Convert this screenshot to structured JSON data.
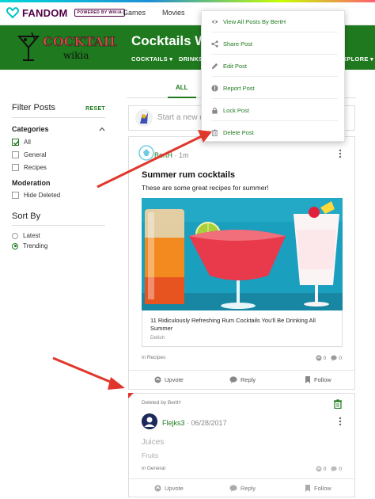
{
  "brand": {
    "name": "FANDOM",
    "powered": "POWERED BY WIKIA"
  },
  "topnav": [
    "Games",
    "Movies"
  ],
  "wiki": {
    "logo_line1": "COCKTAILS",
    "logo_line2": "wikia",
    "title": "Cocktails W",
    "nav": [
      {
        "label": "COCKTAILS ▾"
      },
      {
        "label": "DRINKS"
      },
      {
        "label": "XPLORE ▾"
      }
    ]
  },
  "sidebar": {
    "filter_title": "Filter Posts",
    "reset": "RESET",
    "categories_label": "Categories",
    "categories": [
      {
        "label": "All",
        "checked": true
      },
      {
        "label": "General",
        "checked": false
      },
      {
        "label": "Recipes",
        "checked": false
      }
    ],
    "moderation_label": "Moderation",
    "moderation": [
      {
        "label": "Hide Deleted",
        "checked": false
      }
    ],
    "sort_label": "Sort By",
    "sort": [
      {
        "label": "Latest",
        "selected": false
      },
      {
        "label": "Trending",
        "selected": true
      }
    ]
  },
  "tabs": {
    "active": "ALL"
  },
  "composer": {
    "placeholder": "Start a new di"
  },
  "post1": {
    "author": "BertH",
    "time": "· 1m",
    "title": "Summer rum cocktails",
    "body": "These are some great recipes for summer!",
    "link_title": "11 Ridiculously Refreshing Rum Cocktails You'll Be Drinking All Summer",
    "link_source": "Delish",
    "category": "in Recipes",
    "upvotes": "0",
    "replies": "0",
    "upvote_label": "Upvote",
    "reply_label": "Reply",
    "follow_label": "Follow"
  },
  "post2": {
    "deleted_by": "Deleted by BertH",
    "author": "Flejks3",
    "date": "· 06/28/2017",
    "title": "Juices",
    "body": "Fruits",
    "category": "in General",
    "upvotes": "0",
    "replies": "0",
    "upvote_label": "Upvote",
    "reply_label": "Reply",
    "follow_label": "Follow"
  },
  "menu": {
    "items": [
      {
        "label": "View All Posts By BertH",
        "icon": "eye-icon"
      },
      {
        "label": "Share Post",
        "icon": "share-icon"
      },
      {
        "label": "Edit Post",
        "icon": "pencil-icon"
      },
      {
        "label": "Report Post",
        "icon": "report-icon"
      },
      {
        "label": "Lock Post",
        "icon": "lock-icon"
      },
      {
        "label": "Delete Post",
        "icon": "trash-icon"
      }
    ]
  },
  "colors": {
    "accent": "#1f7a1f",
    "header_bg": "#1f7a1f",
    "arrow": "#e0362b",
    "brand": "#520044"
  }
}
